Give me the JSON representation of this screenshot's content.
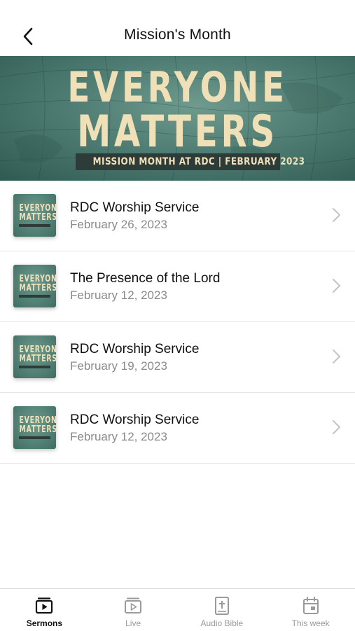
{
  "header": {
    "title": "Mission's Month"
  },
  "banner": {
    "line1": "EVERYONE",
    "line2": "MATTERS",
    "subtitle": "MISSION MONTH AT RDC | FEBRUARY 2023"
  },
  "thumbnail": {
    "line1": "EVERYONE",
    "line2": "MATTERS"
  },
  "sermons": [
    {
      "title": "RDC Worship Service",
      "date": "February 26, 2023"
    },
    {
      "title": "The Presence of the Lord",
      "date": "February 12, 2023"
    },
    {
      "title": "RDC Worship Service",
      "date": "February 19, 2023"
    },
    {
      "title": "RDC Worship Service",
      "date": "February 12, 2023"
    }
  ],
  "tabs": [
    {
      "label": "Sermons",
      "icon": "sermons-icon",
      "active": true
    },
    {
      "label": "Live",
      "icon": "live-icon",
      "active": false
    },
    {
      "label": "Audio Bible",
      "icon": "bible-icon",
      "active": false
    },
    {
      "label": "This week",
      "icon": "calendar-icon",
      "active": false
    }
  ],
  "colors": {
    "banner_green": "#4f7d73",
    "banner_text": "#efe0b8",
    "active_tab": "#111111",
    "inactive_tab": "#9a9a9a"
  }
}
